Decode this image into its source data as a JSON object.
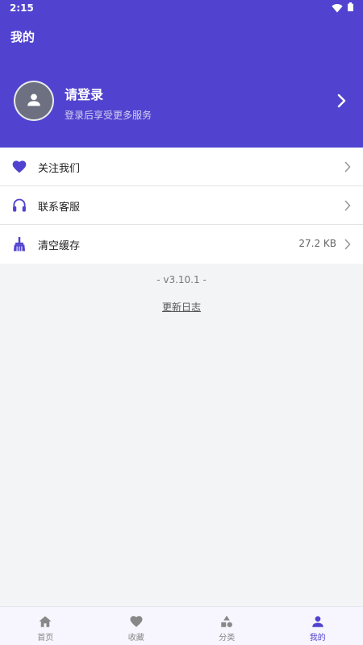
{
  "status_bar": {
    "time": "2:15"
  },
  "header": {
    "title": "我的"
  },
  "profile": {
    "title": "请登录",
    "subtitle": "登录后享受更多服务"
  },
  "menu": {
    "items": [
      {
        "label": "关注我们",
        "icon": "heart-icon"
      },
      {
        "label": "联系客服",
        "icon": "headset-icon"
      },
      {
        "label": "清空缓存",
        "icon": "broom-icon",
        "value": "27.2 KB"
      }
    ]
  },
  "version": "- v3.10.1 -",
  "changelog_link": "更新日志",
  "tabbar": {
    "active_index": 3,
    "tabs": [
      {
        "label": "首页",
        "icon": "home-icon"
      },
      {
        "label": "收藏",
        "icon": "heart-icon"
      },
      {
        "label": "分类",
        "icon": "shapes-icon"
      },
      {
        "label": "我的",
        "icon": "person-icon"
      }
    ]
  },
  "colors": {
    "primary": "#5143cf",
    "background": "#f3f4f6",
    "tabbar_bg": "#f7f5fd",
    "inactive": "#888888"
  }
}
